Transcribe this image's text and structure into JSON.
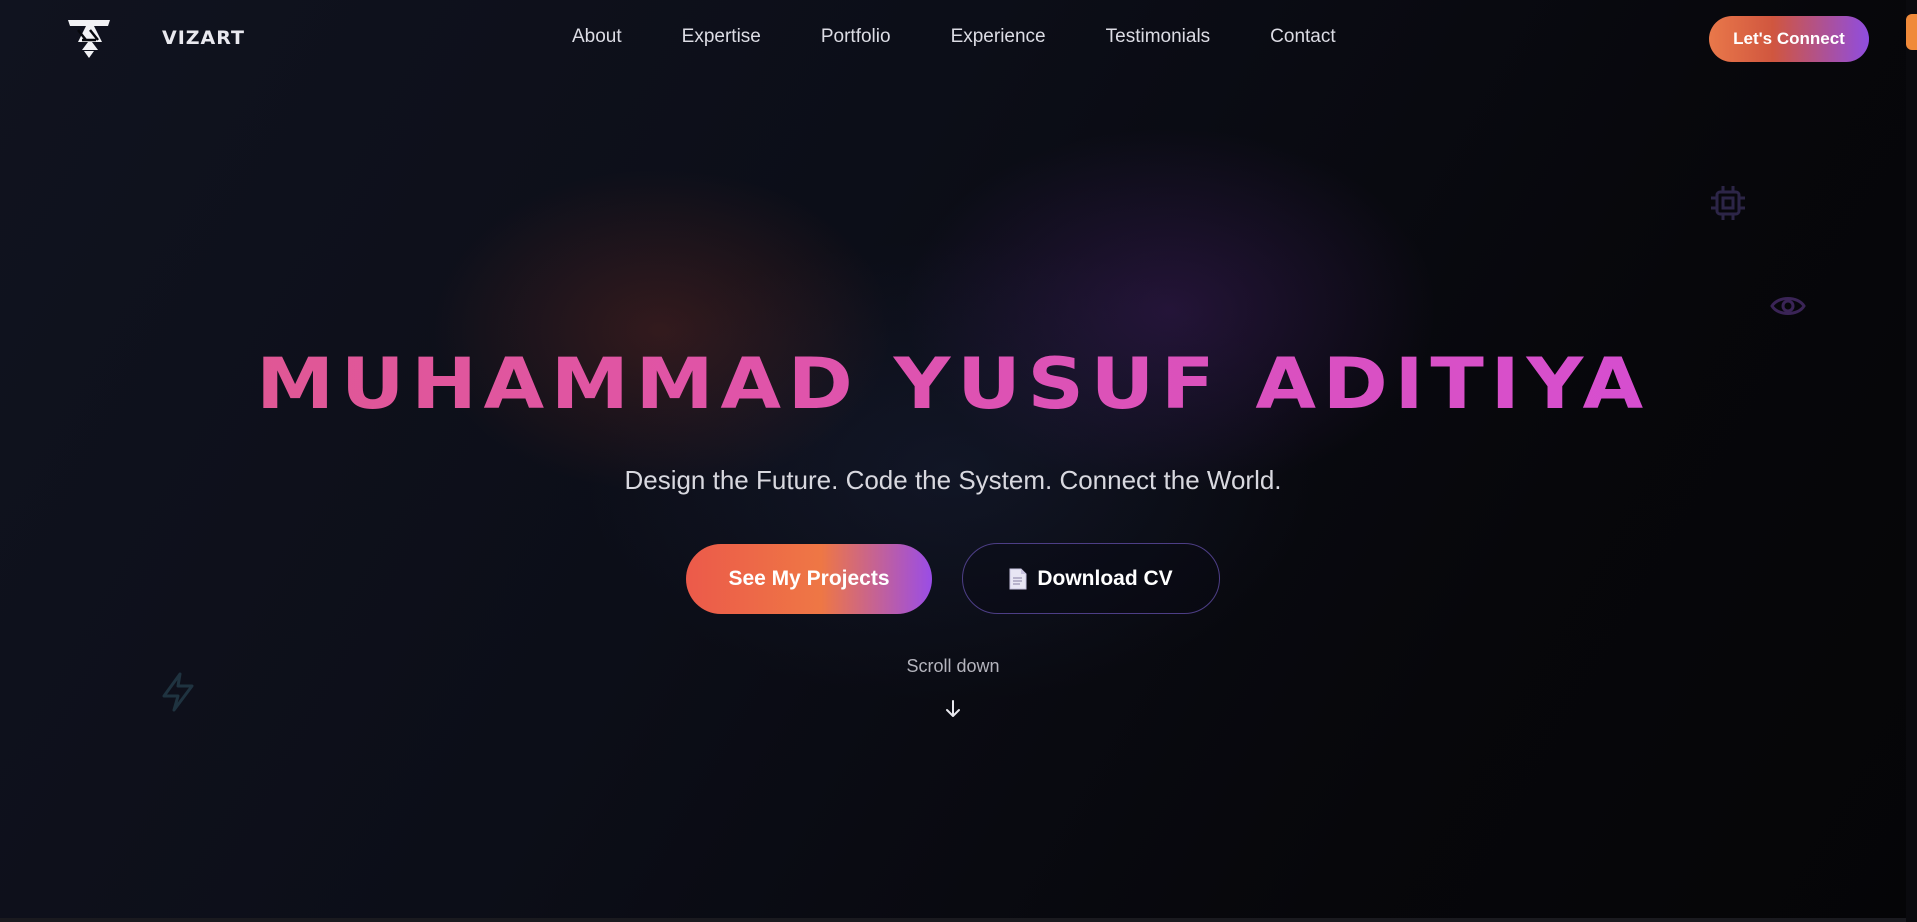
{
  "nav": {
    "brand": "VIZART",
    "logo_icon": "vz-logo-icon",
    "links": [
      "About",
      "Expertise",
      "Portfolio",
      "Experience",
      "Testimonials",
      "Contact"
    ],
    "cta_label": "Let's Connect"
  },
  "hero": {
    "title": "MUHAMMAD YUSUF ADITIYA",
    "tagline": "Design the Future. Code the System. Connect the World.",
    "primary_button": "See My Projects",
    "secondary_button": "Download CV",
    "secondary_icon": "document-icon",
    "scroll_label": "Scroll down",
    "scroll_icon": "arrow-down-icon"
  },
  "decor_icons": [
    "chip-icon",
    "eye-icon",
    "lightning-icon"
  ],
  "colors": {
    "background": "#07080d",
    "title_gradient_start": "#e05a86",
    "title_gradient_end": "#d24ce0",
    "accent_orange": "#ee7745",
    "accent_purple": "#9a4de6"
  }
}
